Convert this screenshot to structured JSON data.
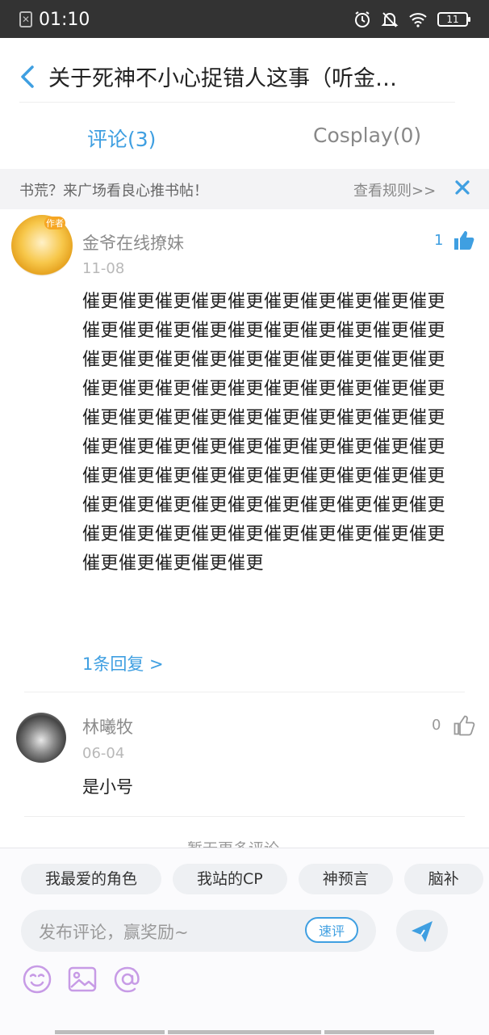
{
  "status_bar": {
    "time": "01:10",
    "battery": "11"
  },
  "header": {
    "title": "关于死神不小心捉错人这事（听金…"
  },
  "tabs": [
    {
      "label": "评论(3)",
      "active": true
    },
    {
      "label": "Cosplay(0)",
      "active": false
    }
  ],
  "notice": {
    "text": "书荒？来广场看良心推书帖！",
    "link": "查看规则>>"
  },
  "comments": [
    {
      "username": "金爷在线撩妹",
      "badge": "作者",
      "date": "11-08",
      "likes": "1",
      "liked": true,
      "text": "催更催更催更催更催更催更催更催更催更催更催更催更催更催更催更催更催更催更催更催更催更催更催更催更催更催更催更催更催更催更催更催更催更催更催更催更催更催更催更催更催更催更催更催更催更催更催更催更催更催更催更催更催更催更催更催更催更催更催更催更催更催更催更催更催更催更催更催更催更催更催更催更催更催更催更催更催更催更催更催更催更催更催更催更催更催更催更催更催更催更催更催更催更催更催更",
      "replies": "1条回复 >"
    },
    {
      "username": "林曦牧",
      "date": "06-04",
      "likes": "0",
      "liked": false,
      "text": "是小号"
    }
  ],
  "more_comments": "暂无更多评论",
  "composer": {
    "chips": [
      "我最爱的角色",
      "我站的CP",
      "神预言",
      "脑补"
    ],
    "placeholder": "发布评论，赢奖励~",
    "quick_label": "速评"
  },
  "colors": {
    "accent": "#3f9fe1",
    "status_bar": "#333333",
    "icon_purple": "#c79be6"
  }
}
